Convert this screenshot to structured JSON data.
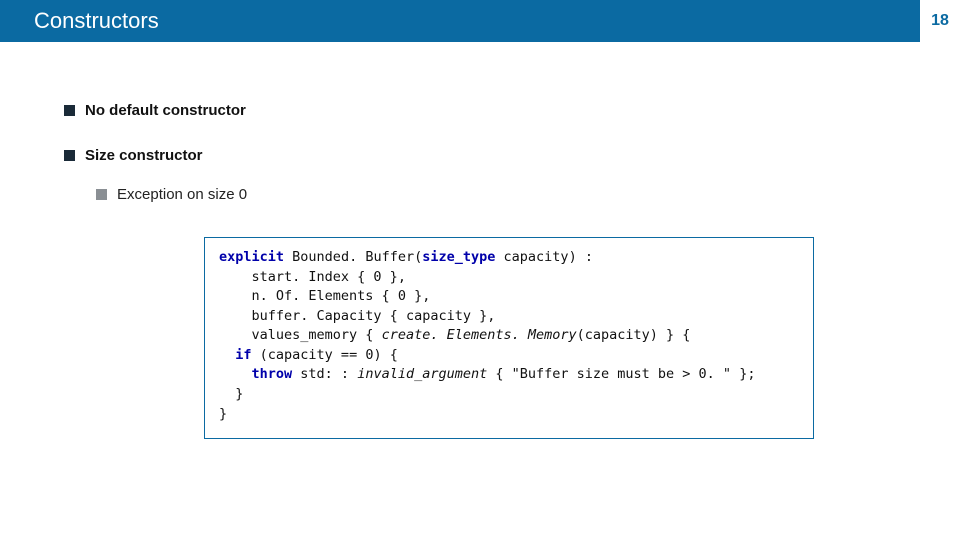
{
  "header": {
    "title": "Constructors",
    "page_number": "18"
  },
  "bullets": {
    "b1": "No default constructor",
    "b2": "Size constructor",
    "b2_sub": "Exception on size 0"
  },
  "code": {
    "kw_explicit": "explicit",
    "ctor_name": "Bounded. Buffer",
    "type_size": "size_type",
    "param_name": "capacity",
    "line_start": "start. Index { 0 },",
    "line_n": "n. Of. Elements { 0 },",
    "line_buf": "buffer. Capacity { capacity },",
    "line_val_prefix": "values_memory { ",
    "fn_create": "create. Elements. Memory",
    "line_val_suffix": "(capacity) } {",
    "kw_if": "if",
    "if_cond": " (capacity == 0) {",
    "kw_throw": "throw",
    "throw_type": " std: : ",
    "throw_arg": "invalid_argument",
    "throw_msg": " { \"Buffer size must be > 0. \" };",
    "brace_close1": "}",
    "brace_close2": "}",
    "brace_close3": "}"
  }
}
